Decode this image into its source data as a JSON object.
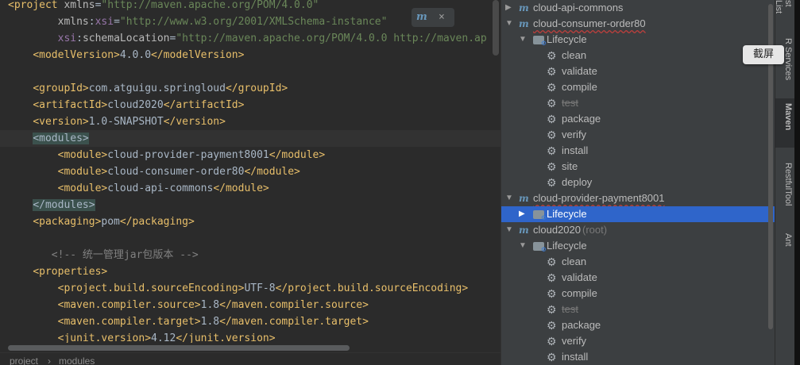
{
  "editor": {
    "lines": [
      {
        "parts": [
          [
            "tag",
            "<project "
          ],
          [
            "attr",
            "xmlns"
          ],
          [
            "txt",
            "="
          ],
          [
            "val",
            "\"http://maven.apache.org/POM/4.0.0\""
          ]
        ]
      },
      {
        "parts": [
          [
            "txt",
            "        "
          ],
          [
            "attr",
            "xmlns"
          ],
          [
            "txt",
            ":"
          ],
          [
            "ns",
            "xsi"
          ],
          [
            "txt",
            "="
          ],
          [
            "val",
            "\"http://www.w3.org/2001/XMLSchema-instance\""
          ]
        ]
      },
      {
        "parts": [
          [
            "txt",
            "        "
          ],
          [
            "ns",
            "xsi"
          ],
          [
            "txt",
            ":"
          ],
          [
            "attr",
            "schemaLocation"
          ],
          [
            "txt",
            "="
          ],
          [
            "val",
            "\"http://maven.apache.org/POM/4.0.0 http://maven.ap"
          ]
        ]
      },
      {
        "parts": [
          [
            "txt",
            "    "
          ],
          [
            "tag",
            "<modelVersion>"
          ],
          [
            "txt",
            "4.0.0"
          ],
          [
            "tag",
            "</modelVersion>"
          ]
        ]
      },
      {
        "parts": []
      },
      {
        "parts": [
          [
            "txt",
            "    "
          ],
          [
            "tag",
            "<groupId>"
          ],
          [
            "txt",
            "com.atguigu.springloud"
          ],
          [
            "tag",
            "</groupId>"
          ]
        ]
      },
      {
        "parts": [
          [
            "txt",
            "    "
          ],
          [
            "tag",
            "<artifactId>"
          ],
          [
            "txt",
            "cloud2020"
          ],
          [
            "tag",
            "</artifactId>"
          ]
        ]
      },
      {
        "parts": [
          [
            "txt",
            "    "
          ],
          [
            "tag",
            "<version>"
          ],
          [
            "txt",
            "1.0-SNAPSHOT"
          ],
          [
            "tag",
            "</version>"
          ]
        ]
      },
      {
        "parts": [
          [
            "txt",
            "    "
          ],
          [
            "tagbg",
            "<modules>"
          ]
        ]
      },
      {
        "parts": [
          [
            "txt",
            "        "
          ],
          [
            "tag",
            "<module>"
          ],
          [
            "txt",
            "cloud-provider-payment8001"
          ],
          [
            "tag",
            "</module>"
          ]
        ]
      },
      {
        "parts": [
          [
            "txt",
            "        "
          ],
          [
            "tag",
            "<module>"
          ],
          [
            "txt",
            "cloud-consumer-order80"
          ],
          [
            "tag",
            "</module>"
          ]
        ]
      },
      {
        "parts": [
          [
            "txt",
            "        "
          ],
          [
            "tag",
            "<module>"
          ],
          [
            "txt",
            "cloud-api-commons"
          ],
          [
            "tag",
            "</module>"
          ]
        ]
      },
      {
        "parts": [
          [
            "txt",
            "    "
          ],
          [
            "tagbg",
            "</modules>"
          ]
        ]
      },
      {
        "parts": [
          [
            "txt",
            "    "
          ],
          [
            "tag",
            "<packaging>"
          ],
          [
            "txt",
            "pom"
          ],
          [
            "tag",
            "</packaging>"
          ]
        ]
      },
      {
        "parts": []
      },
      {
        "parts": [
          [
            "txt",
            "       "
          ],
          [
            "cmt",
            "<!-- 统一管理jar包版本 -->"
          ]
        ]
      },
      {
        "parts": [
          [
            "txt",
            "    "
          ],
          [
            "tag",
            "<properties>"
          ]
        ]
      },
      {
        "parts": [
          [
            "txt",
            "        "
          ],
          [
            "tag",
            "<project.build.sourceEncoding>"
          ],
          [
            "txt",
            "UTF-8"
          ],
          [
            "tag",
            "</project.build.sourceEncoding>"
          ]
        ]
      },
      {
        "parts": [
          [
            "txt",
            "        "
          ],
          [
            "tag",
            "<maven.compiler.source>"
          ],
          [
            "txt",
            "1.8"
          ],
          [
            "tag",
            "</maven.compiler.source>"
          ]
        ]
      },
      {
        "parts": [
          [
            "txt",
            "        "
          ],
          [
            "tag",
            "<maven.compiler.target>"
          ],
          [
            "txt",
            "1.8"
          ],
          [
            "tag",
            "</maven.compiler.target>"
          ]
        ]
      },
      {
        "parts": [
          [
            "txt",
            "        "
          ],
          [
            "tag",
            "<junit.version>"
          ],
          [
            "txt",
            "4.12"
          ],
          [
            "tag",
            "</junit.version>"
          ]
        ]
      }
    ],
    "popup": {
      "icon": "maven-icon",
      "close": "×"
    },
    "breadcrumb": {
      "item1": "project",
      "sep": "›",
      "item2": "modules"
    }
  },
  "maven": {
    "tree": [
      {
        "arrow": "▶",
        "icon": "module",
        "label": "cloud-api-commons",
        "level": 0
      },
      {
        "arrow": "▼",
        "icon": "module",
        "label": "cloud-consumer-order80",
        "level": 0,
        "squiggle": true
      },
      {
        "arrow": "▼",
        "icon": "folder",
        "label": "Lifecycle",
        "level": 1
      },
      {
        "icon": "gear",
        "label": "clean",
        "level": 2
      },
      {
        "icon": "gear",
        "label": "validate",
        "level": 2
      },
      {
        "icon": "gear",
        "label": "compile",
        "level": 2
      },
      {
        "icon": "gear",
        "label": "test",
        "level": 2,
        "muted": true
      },
      {
        "icon": "gear",
        "label": "package",
        "level": 2
      },
      {
        "icon": "gear",
        "label": "verify",
        "level": 2
      },
      {
        "icon": "gear",
        "label": "install",
        "level": 2
      },
      {
        "icon": "gear",
        "label": "site",
        "level": 2
      },
      {
        "icon": "gear",
        "label": "deploy",
        "level": 2
      },
      {
        "arrow": "▼",
        "icon": "module",
        "label": "cloud-provider-payment8001",
        "level": 0,
        "squiggle": true
      },
      {
        "arrow": "▶",
        "icon": "folder",
        "label": "Lifecycle",
        "level": 1,
        "selected": true
      },
      {
        "arrow": "▼",
        "icon": "module",
        "label": "cloud2020",
        "suffix": "(root)",
        "level": 0
      },
      {
        "arrow": "▼",
        "icon": "folder",
        "label": "Lifecycle",
        "level": 1
      },
      {
        "icon": "gear",
        "label": "clean",
        "level": 2
      },
      {
        "icon": "gear",
        "label": "validate",
        "level": 2
      },
      {
        "icon": "gear",
        "label": "compile",
        "level": 2
      },
      {
        "icon": "gear",
        "label": "test",
        "level": 2,
        "muted": true
      },
      {
        "icon": "gear",
        "label": "package",
        "level": 2
      },
      {
        "icon": "gear",
        "label": "verify",
        "level": 2
      },
      {
        "icon": "gear",
        "label": "install",
        "level": 2
      }
    ]
  },
  "strip": {
    "tabs": [
      {
        "name": "tab-structlist",
        "label": "st List"
      },
      {
        "name": "tab-resources",
        "label": "R Services"
      },
      {
        "name": "tab-maven",
        "label": "Maven",
        "icon": "m"
      },
      {
        "name": "tab-restfultool",
        "label": "RestfulTool",
        "icon": "🌐"
      },
      {
        "name": "tab-ant",
        "label": "Ant",
        "icon": "🐜"
      }
    ]
  },
  "tooltip": "截屏"
}
